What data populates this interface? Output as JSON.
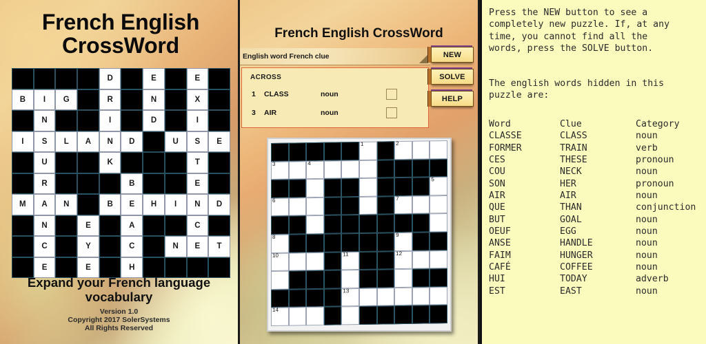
{
  "left": {
    "title": "French English CrossWord",
    "footer": {
      "tagline": "Expand your French language vocabulary",
      "version": "Version 1.0",
      "copyright": "Copyright 2017 SolerSystems",
      "rights": "All Rights Reserved"
    },
    "grid": {
      "rows": 10,
      "cols": 10,
      "letters": [
        [
          "",
          "",
          "",
          "",
          "D",
          "",
          "E",
          "",
          "E",
          ""
        ],
        [
          "B",
          "I",
          "G",
          "",
          "R",
          "",
          "N",
          "",
          "X",
          ""
        ],
        [
          "",
          "N",
          "",
          "",
          "I",
          "",
          "D",
          "",
          "I",
          ""
        ],
        [
          "I",
          "S",
          "L",
          "A",
          "N",
          "D",
          "",
          "U",
          "S",
          "E"
        ],
        [
          "",
          "U",
          "",
          "",
          "K",
          "",
          "",
          "",
          "T",
          ""
        ],
        [
          "",
          "R",
          "",
          "",
          "",
          "B",
          "",
          "",
          "E",
          ""
        ],
        [
          "M",
          "A",
          "N",
          "",
          "B",
          "E",
          "H",
          "I",
          "N",
          "D"
        ],
        [
          "",
          "N",
          "",
          "E",
          "",
          "A",
          "",
          "",
          "C",
          ""
        ],
        [
          "",
          "C",
          "",
          "Y",
          "",
          "C",
          "",
          "N",
          "E",
          "T"
        ],
        [
          "",
          "E",
          "",
          "E",
          "",
          "H",
          "",
          "",
          "",
          ""
        ]
      ]
    }
  },
  "middle": {
    "title": "French English CrossWord",
    "wordbar_label": "English word French clue",
    "clues_header": "ACROSS",
    "clues": [
      {
        "num": "1",
        "word": "CLASS",
        "category": "noun"
      },
      {
        "num": "3",
        "word": "AIR",
        "category": "noun"
      }
    ],
    "buttons": [
      {
        "label": "NEW"
      },
      {
        "label": "SOLVE"
      },
      {
        "label": "HELP"
      }
    ],
    "grid": {
      "rows": 10,
      "cols": 10,
      "black": [
        [
          1,
          1,
          1,
          1,
          1,
          0,
          1,
          0,
          0,
          0
        ],
        [
          0,
          0,
          0,
          0,
          0,
          0,
          1,
          1,
          1,
          1
        ],
        [
          1,
          1,
          0,
          1,
          1,
          0,
          1,
          1,
          1,
          0
        ],
        [
          0,
          0,
          0,
          1,
          1,
          0,
          1,
          0,
          0,
          0
        ],
        [
          1,
          1,
          0,
          1,
          1,
          1,
          1,
          1,
          1,
          0
        ],
        [
          0,
          1,
          1,
          1,
          1,
          1,
          1,
          0,
          1,
          1
        ],
        [
          0,
          0,
          0,
          1,
          0,
          1,
          1,
          0,
          0,
          0
        ],
        [
          0,
          1,
          1,
          1,
          0,
          1,
          1,
          0,
          1,
          1
        ],
        [
          1,
          1,
          1,
          1,
          0,
          0,
          0,
          0,
          0,
          0
        ],
        [
          0,
          0,
          0,
          1,
          0,
          1,
          1,
          1,
          1,
          1
        ]
      ],
      "numbers": [
        [
          "",
          "",
          "",
          "",
          "",
          "1",
          "",
          "2",
          "",
          ""
        ],
        [
          "3",
          "",
          "4",
          "",
          "",
          "",
          "",
          "",
          "",
          ""
        ],
        [
          "",
          "",
          "",
          "",
          "",
          "",
          "",
          "",
          "",
          "5"
        ],
        [
          "6",
          "",
          "",
          "",
          "",
          "",
          "",
          "7",
          "",
          ""
        ],
        [
          "",
          "",
          "",
          "",
          "",
          "",
          "",
          "",
          "",
          ""
        ],
        [
          "8",
          "",
          "",
          "",
          "",
          "",
          "",
          "9",
          "",
          ""
        ],
        [
          "10",
          "",
          "",
          "",
          "11",
          "",
          "",
          "12",
          "",
          ""
        ],
        [
          "",
          "",
          "",
          "",
          "",
          "",
          "",
          "",
          "",
          ""
        ],
        [
          "",
          "",
          "",
          "",
          "13",
          "",
          "",
          "",
          "",
          ""
        ],
        [
          "14",
          "",
          "",
          "",
          "",
          "",
          "",
          "",
          "",
          ""
        ]
      ]
    }
  },
  "right": {
    "intro": "Press the NEW button to see a\ncompletely new puzzle. If, at any\ntime, you cannot find all the\nwords, press the SOLVE button.",
    "subhead": "The english words hidden in this\npuzzle are:",
    "columns": [
      "Word",
      "Clue",
      "Category"
    ],
    "words": [
      {
        "word": "CLASSE",
        "clue": "CLASS",
        "category": "noun"
      },
      {
        "word": "FORMER",
        "clue": "TRAIN",
        "category": "verb"
      },
      {
        "word": "CES",
        "clue": "THESE",
        "category": "pronoun"
      },
      {
        "word": "COU",
        "clue": "NECK",
        "category": "noun"
      },
      {
        "word": "SON",
        "clue": "HER",
        "category": "pronoun"
      },
      {
        "word": "AIR",
        "clue": "AIR",
        "category": "noun"
      },
      {
        "word": "QUE",
        "clue": "THAN",
        "category": "conjunction"
      },
      {
        "word": "BUT",
        "clue": "GOAL",
        "category": "noun"
      },
      {
        "word": "OEUF",
        "clue": "EGG",
        "category": "noun"
      },
      {
        "word": "ANSE",
        "clue": "HANDLE",
        "category": "noun"
      },
      {
        "word": "FAIM",
        "clue": "HUNGER",
        "category": "noun"
      },
      {
        "word": "CAFÉ",
        "clue": "COFFEE",
        "category": "noun"
      },
      {
        "word": "HUI",
        "clue": "TODAY",
        "category": "adverb"
      },
      {
        "word": "EST",
        "clue": "EAST",
        "category": "noun"
      }
    ]
  },
  "colors": {
    "note_bg": "#fbfbbe",
    "clue_panel_bg": "#f7eab4",
    "clue_panel_border": "#e0673a",
    "button_face": "#fbe79e",
    "cell_black": "#000000"
  }
}
